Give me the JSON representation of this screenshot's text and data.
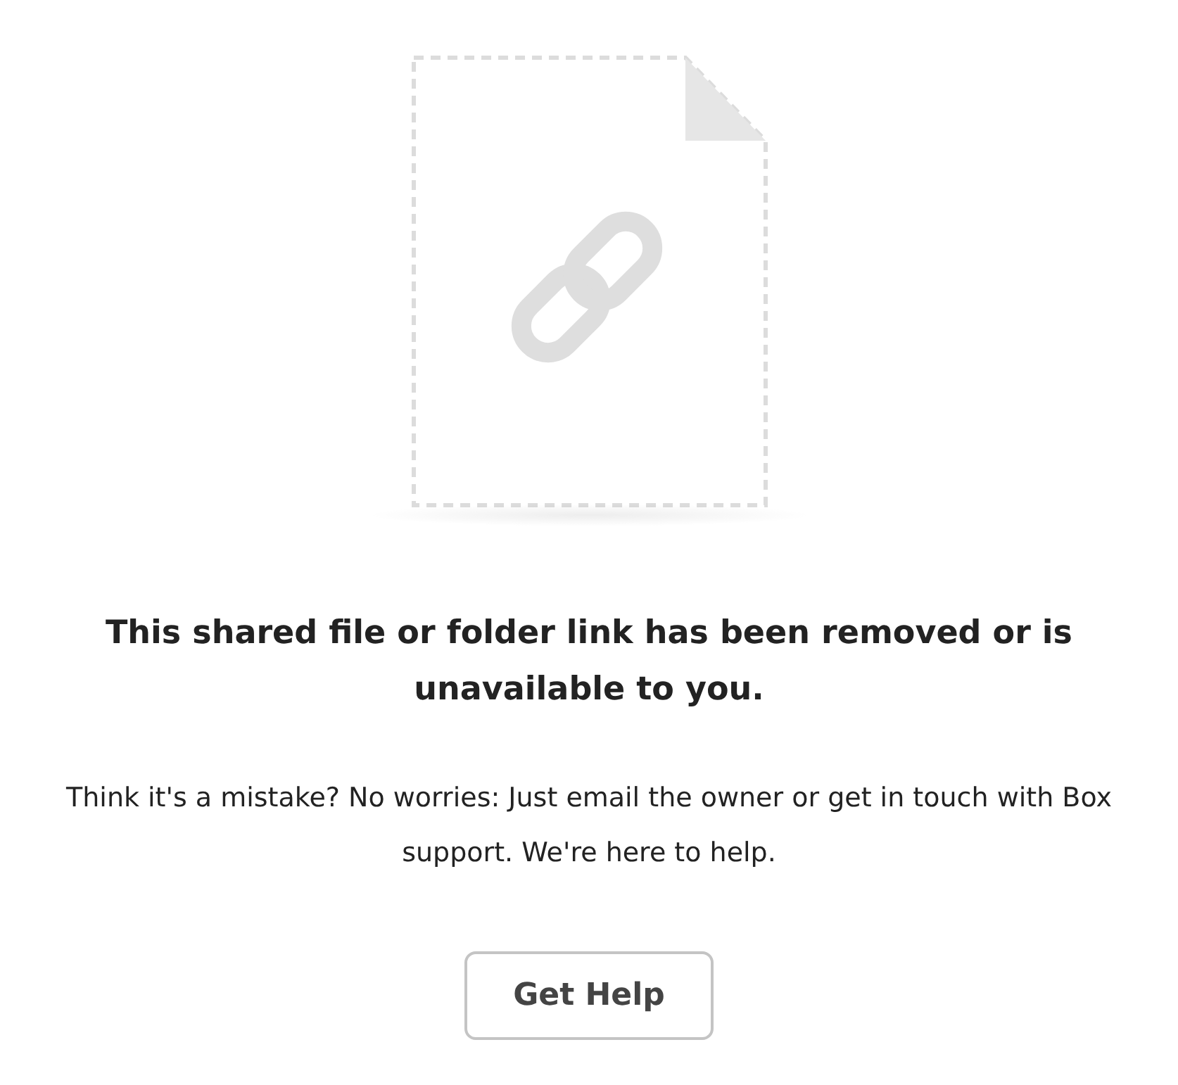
{
  "message": {
    "title": "This shared file or folder link has been removed or is unavailable to you.",
    "body": "Think it's a mistake? No worries: Just email the owner or get in touch with Box support. We're here to help."
  },
  "button": {
    "label": "Get Help"
  }
}
